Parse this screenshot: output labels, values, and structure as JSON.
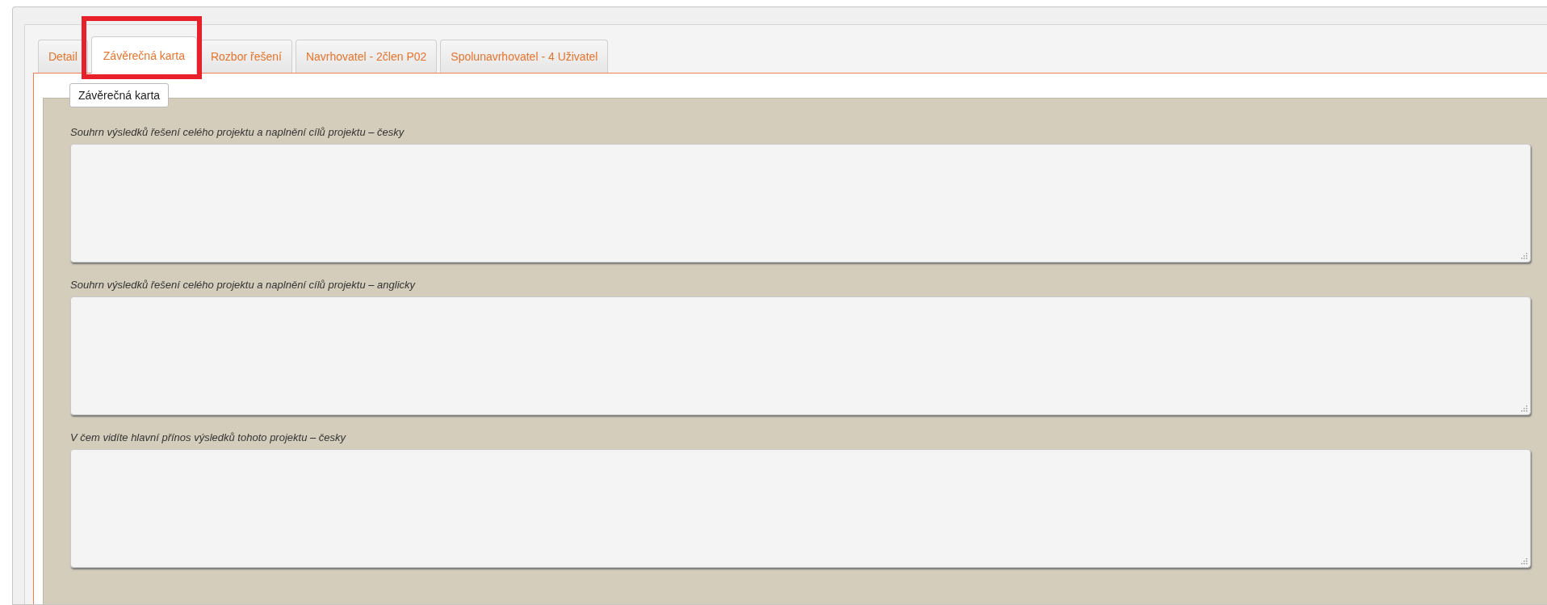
{
  "tabs": [
    {
      "label": "Detail",
      "selected": false,
      "highlighted": false
    },
    {
      "label": "Závěrečná karta",
      "selected": true,
      "highlighted": true
    },
    {
      "label": "Rozbor řešení",
      "selected": false,
      "highlighted": false
    },
    {
      "label": "Navrhovatel - 2člen P02",
      "selected": false,
      "highlighted": false
    },
    {
      "label": "Spolunavrhovatel - 4 Uživatel",
      "selected": false,
      "highlighted": false
    }
  ],
  "fieldset": {
    "legend": "Závěrečná karta",
    "fields": [
      {
        "label": "Souhrn výsledků řešení celého projektu a naplnění cílů projektu – česky"
      },
      {
        "label": "Souhrn výsledků řešení celého projektu a naplnění cílů projektu – anglicky"
      },
      {
        "label": "V čem vidíte hlavní přínos výsledků tohoto projektu – česky"
      }
    ]
  }
}
